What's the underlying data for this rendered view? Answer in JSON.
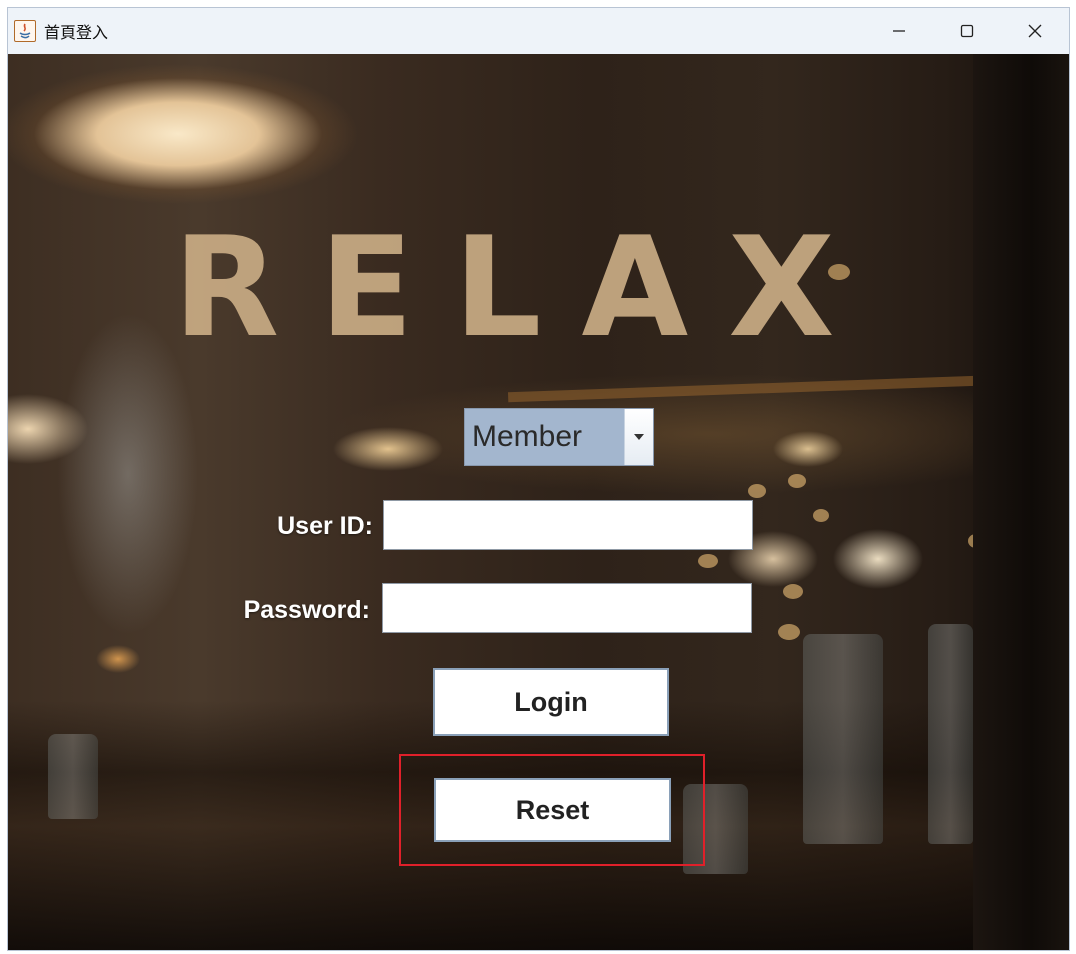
{
  "window": {
    "title": "首頁登入",
    "controls": {
      "minimize": "minimize-icon",
      "maximize": "maximize-icon",
      "close": "close-icon"
    }
  },
  "hero": {
    "text": "RELAX"
  },
  "login_form": {
    "role_select": {
      "value": "Member"
    },
    "user_id": {
      "label": "User ID:",
      "value": ""
    },
    "password": {
      "label": "Password:",
      "value": ""
    },
    "login_button": "Login",
    "reset_button": "Reset"
  },
  "colors": {
    "hero_text": "#c8ab84",
    "select_bg": "#a3b6ce",
    "highlight_border": "#e0202a"
  }
}
